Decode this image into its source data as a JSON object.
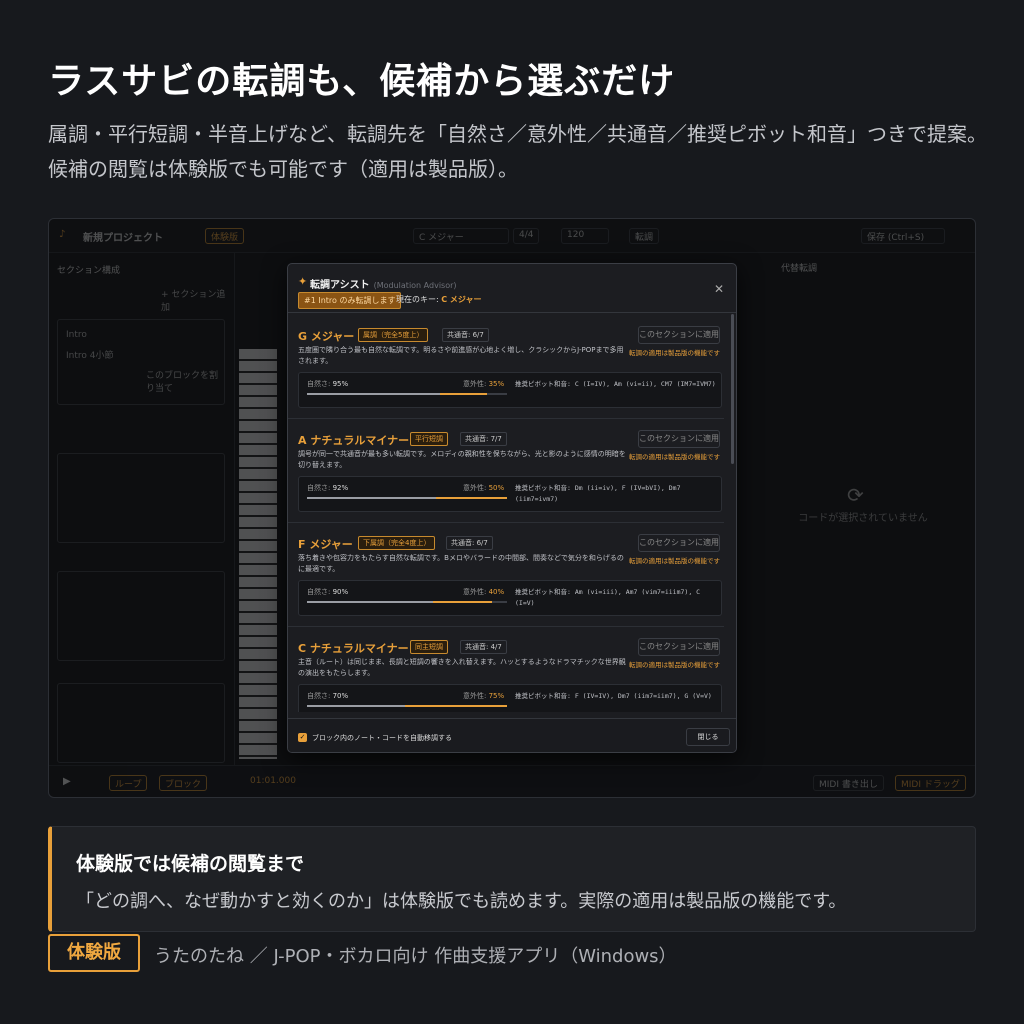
{
  "hero": {
    "title": "ラスサビの転調も、候補から選ぶだけ",
    "subtitle_line1": "属調・平行短調・半音上げなど、転調先を「自然さ／意外性／共通音／推奨ピボット和音」つきで提案。",
    "subtitle_line2": "候補の閲覧は体験版でも可能です（適用は製品版）。"
  },
  "app": {
    "project_title": "新規プロジェクト",
    "trial_tag": "体験版",
    "key_label": "C メジャー",
    "time_sig": "4/4",
    "tempo": "120",
    "modulate_button": "転調",
    "save_button": "保存 (Ctrl+S)",
    "left_tab_sections": "セクション構成",
    "add_section": "+ セクション追加",
    "section_intro": "Intro",
    "section_intro_sub": "Intro 4小節",
    "copy_block": "このブロックを割り当て",
    "right_tab": "代替転調",
    "no_chord": "コードが選択されていません",
    "loop": "ループ",
    "block": "ブロック",
    "time_readout": "01:01.000",
    "midi_export": "MIDI 書き出し",
    "midi_drag": "MIDI ドラッグ"
  },
  "modal": {
    "title": "転調アシスト",
    "title_en": "(Modulation Advisor)",
    "badge": "#1 Intro のみ転調します",
    "current_key_label": "現在のキー:",
    "current_key": "C メジャー",
    "apply_label": "このセクションに適用",
    "apply_note": "転調の適用は製品版の機能です",
    "naturalness_label": "自然さ:",
    "surprise_label": "意外性:",
    "pivot_label": "推奨ピボット和音:",
    "footer_checkbox": "ブロック内のノート・コードを自動移調する",
    "close_button": "閉じる",
    "candidates": [
      {
        "key": "G メジャー",
        "tag": "属調（完全5度上）",
        "common": "共通音: 6/7",
        "desc": "五度圏で隣り合う最も自然な転調です。明るさや前進感が心地よく増し、クラシックからJ-POPまで多用されます。",
        "naturalness": "95%",
        "naturalness_value": 0.95,
        "surprise": "35%",
        "surprise_value": 0.35,
        "pivot": "C (I=IV), Am (vi=ii), CM7 (IM7=IVM7)"
      },
      {
        "key": "A ナチュラルマイナー",
        "tag": "平行短調",
        "common": "共通音: 7/7",
        "desc": "調号が同一で共通音が最も多い転調です。メロディの親和性を保ちながら、光と影のように感情の明暗を切り替えます。",
        "naturalness": "92%",
        "naturalness_value": 0.92,
        "surprise": "50%",
        "surprise_value": 0.5,
        "pivot": "Dm (ii=iv), F (IV=bVI), Dm7 (iim7=ivm7)"
      },
      {
        "key": "F メジャー",
        "tag": "下属調（完全4度上）",
        "common": "共通音: 6/7",
        "desc": "落ち着きや包容力をもたらす自然な転調です。Bメロやバラードの中間部、間奏などで気分を和らげるのに最適です。",
        "naturalness": "90%",
        "naturalness_value": 0.9,
        "surprise": "40%",
        "surprise_value": 0.4,
        "pivot": "Am (vi=iii), Am7 (vim7=iiim7), C (I=V)"
      },
      {
        "key": "C ナチュラルマイナー",
        "tag": "同主短調",
        "common": "共通音: 4/7",
        "desc": "主音（ルート）は同じまま、長調と短調の響きを入れ替えます。ハッとするようなドラマチックな世界観の演出をもたらします。",
        "naturalness": "70%",
        "naturalness_value": 0.7,
        "surprise": "75%",
        "surprise_value": 0.75,
        "pivot": "F (IV=IV), Dm7 (iim7=iim7), G (V=V)"
      }
    ]
  },
  "callout": {
    "heading": "体験版では候補の閲覧まで",
    "body": "「どの調へ、なぜ動かすと効くのか」は体験版でも読めます。実際の適用は製品版の機能です。"
  },
  "footer": {
    "badge": "体験版",
    "text": "うたのたね ／ J-POP・ボカロ向け 作曲支援アプリ（Windows）"
  },
  "colors": {
    "accent": "#e8a03a",
    "background": "#17191d"
  }
}
